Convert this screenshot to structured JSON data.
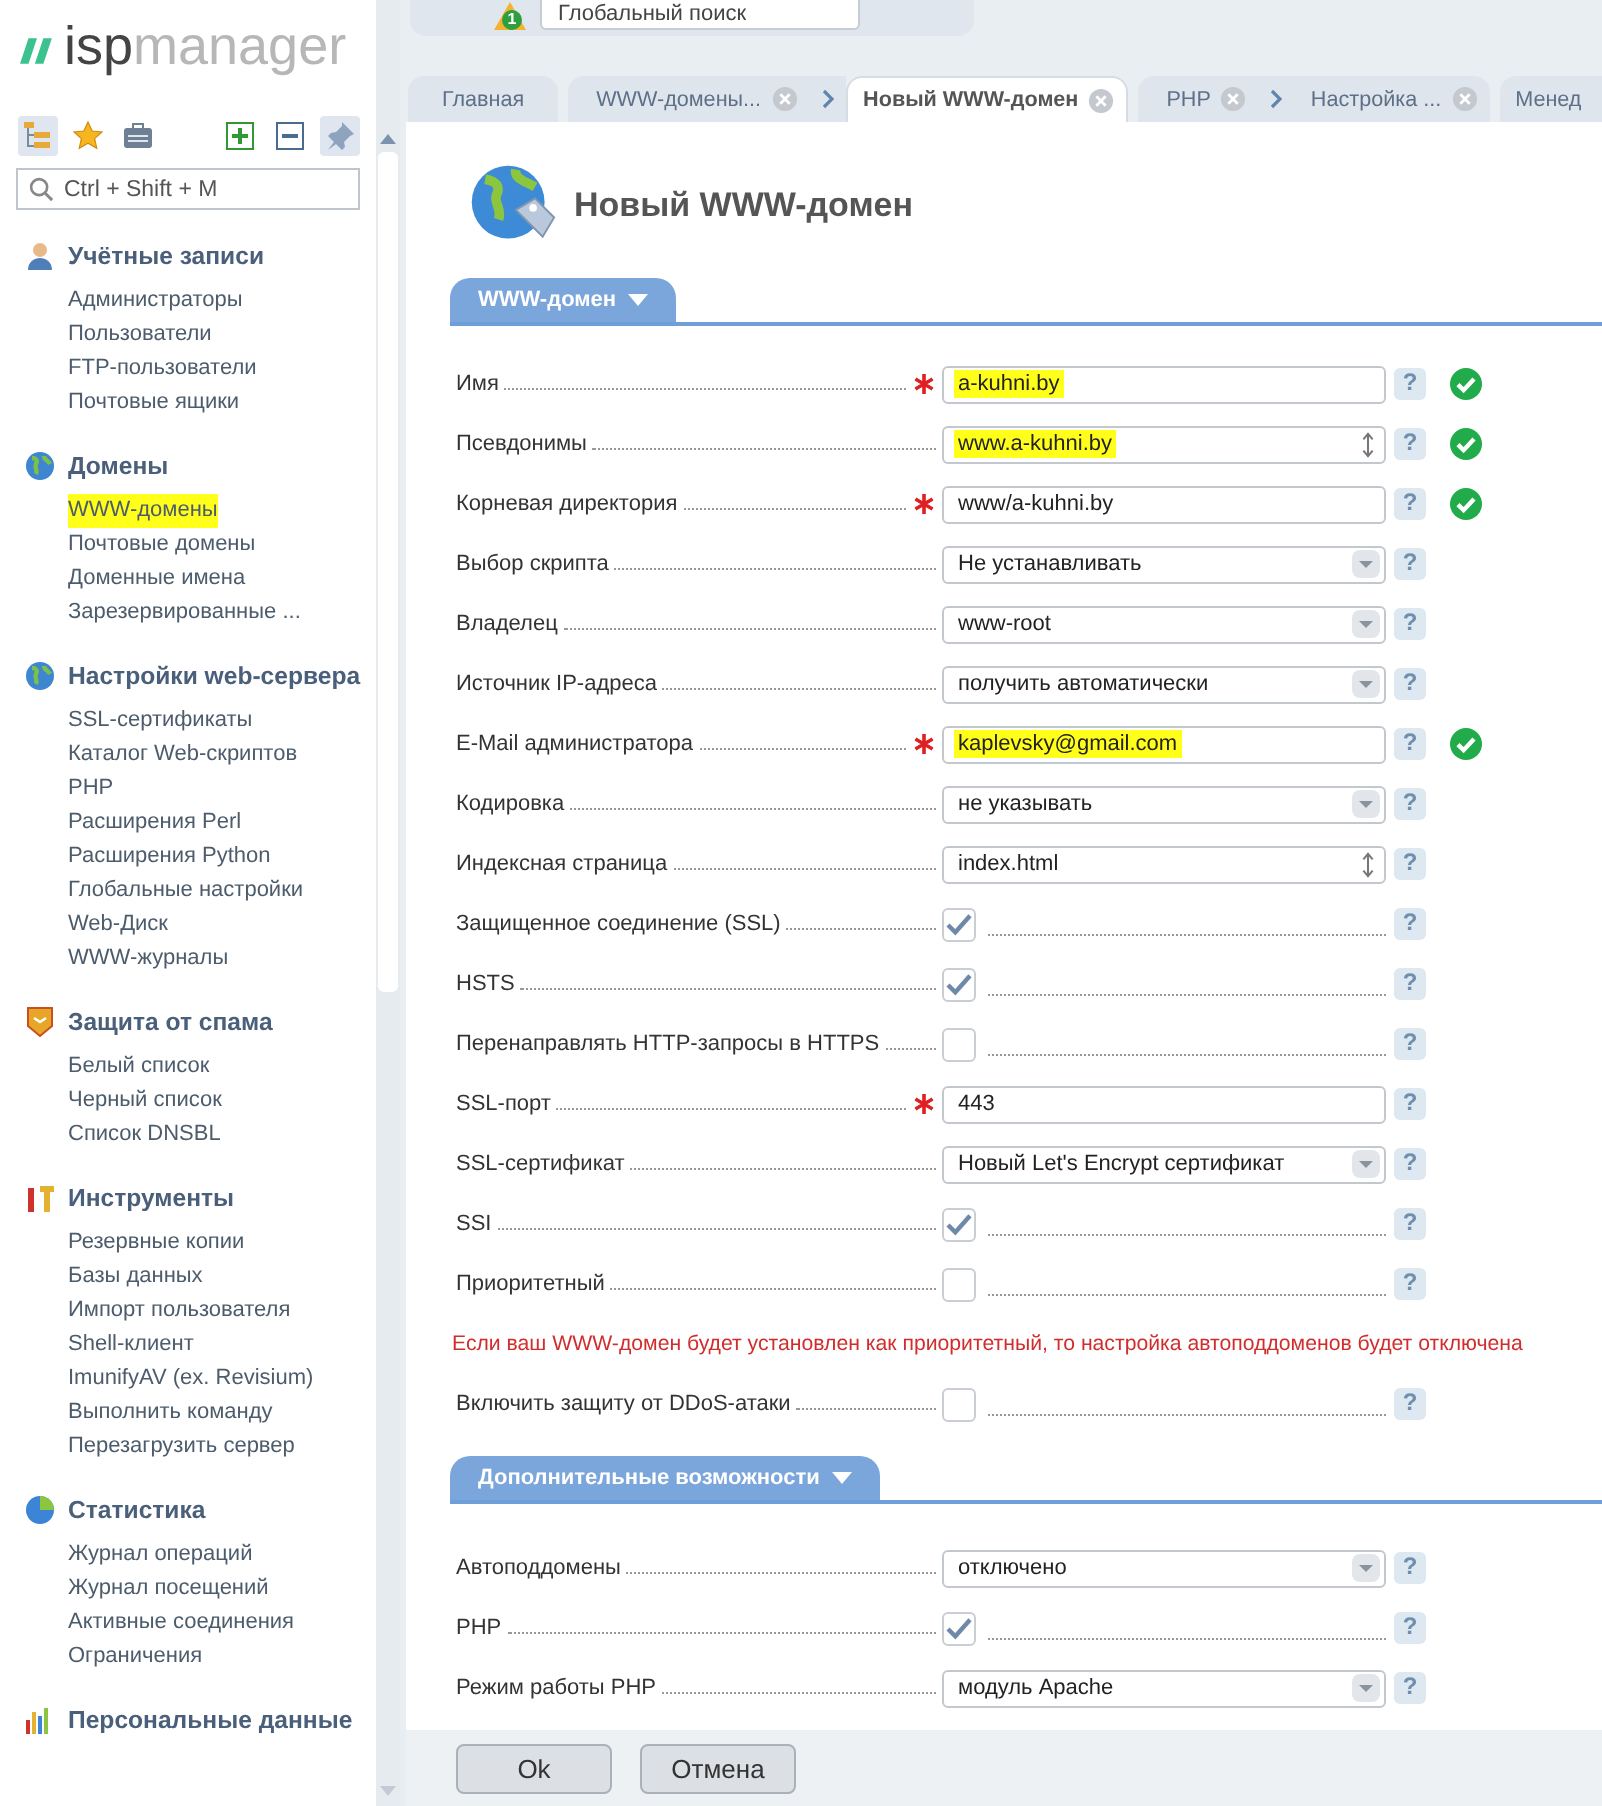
{
  "logo": {
    "prefix": "isp",
    "suffix": "manager"
  },
  "sidebar_toolbar": [
    {
      "selected": true
    },
    {
      "selected": false
    },
    {
      "selected": false
    },
    {
      "selected": false
    },
    {
      "selected": false
    },
    {
      "selected": true
    }
  ],
  "sidebar_search": {
    "placeholder": "Ctrl + Shift + M"
  },
  "sidebar": {
    "groups": [
      {
        "title": "Учётные записи",
        "items": [
          {
            "label": "Администраторы",
            "highlighted": false
          },
          {
            "label": "Пользователи",
            "highlighted": false
          },
          {
            "label": "FTP-пользователи",
            "highlighted": false
          },
          {
            "label": "Почтовые ящики",
            "highlighted": false
          }
        ]
      },
      {
        "title": "Домены",
        "items": [
          {
            "label": "WWW-домены",
            "highlighted": true
          },
          {
            "label": "Почтовые домены",
            "highlighted": false
          },
          {
            "label": "Доменные имена",
            "highlighted": false
          },
          {
            "label": "Зарезервированные ...",
            "highlighted": false
          }
        ]
      },
      {
        "title": "Настройки web-сервера",
        "items": [
          {
            "label": "SSL-сертификаты",
            "highlighted": false
          },
          {
            "label": "Каталог Web-скриптов",
            "highlighted": false
          },
          {
            "label": "PHP",
            "highlighted": false
          },
          {
            "label": "Расширения Perl",
            "highlighted": false
          },
          {
            "label": "Расширения Python",
            "highlighted": false
          },
          {
            "label": "Глобальные настройки",
            "highlighted": false
          },
          {
            "label": "Web-Диск",
            "highlighted": false
          },
          {
            "label": "WWW-журналы",
            "highlighted": false
          }
        ]
      },
      {
        "title": "Защита от спама",
        "items": [
          {
            "label": "Белый список",
            "highlighted": false
          },
          {
            "label": "Черный список",
            "highlighted": false
          },
          {
            "label": "Список DNSBL",
            "highlighted": false
          }
        ]
      },
      {
        "title": "Инструменты",
        "items": [
          {
            "label": "Резервные копии",
            "highlighted": false
          },
          {
            "label": "Базы данных",
            "highlighted": false
          },
          {
            "label": "Импорт пользователя",
            "highlighted": false
          },
          {
            "label": "Shell-клиент",
            "highlighted": false
          },
          {
            "label": "ImunifyAV (ex. Revisium)",
            "highlighted": false
          },
          {
            "label": "Выполнить команду",
            "highlighted": false
          },
          {
            "label": "Перезагрузить сервер",
            "highlighted": false
          }
        ]
      },
      {
        "title": "Статистика",
        "items": [
          {
            "label": "Журнал операций",
            "highlighted": false
          },
          {
            "label": "Журнал посещений",
            "highlighted": false
          },
          {
            "label": "Активные соединения",
            "highlighted": false
          },
          {
            "label": "Ограничения",
            "highlighted": false
          }
        ]
      },
      {
        "title": "Персональные данные"
      }
    ]
  },
  "header": {
    "alert_count": "1",
    "search": {
      "placeholder": "Глобальный поиск"
    }
  },
  "tabs": [
    {
      "label": "Главная",
      "selected": false,
      "closable": false,
      "linked": false
    },
    {
      "label": "WWW-домены...",
      "selected": false,
      "closable": true,
      "linked": false
    },
    {
      "label": "Новый WWW-домен",
      "selected": true,
      "closable": true,
      "linked": true
    },
    {
      "label": "PHP",
      "selected": false,
      "closable": true,
      "linked": false
    },
    {
      "label": "Настройка ...",
      "selected": false,
      "closable": true,
      "linked": true
    },
    {
      "label": "Менед",
      "selected": false,
      "closable": false,
      "linked": false
    }
  ],
  "page_title": "Новый WWW-домен",
  "sections": [
    {
      "title": "WWW-домен",
      "rows": [
        {
          "kind": "text",
          "label": "Имя",
          "required": true,
          "value": "a-kuhni.by",
          "highlighted": true,
          "valid": true,
          "help": "?"
        },
        {
          "kind": "spin",
          "label": "Псевдонимы",
          "required": false,
          "value": "www.a-kuhni.by",
          "highlighted": true,
          "valid": true,
          "help": "?"
        },
        {
          "kind": "text",
          "label": "Корневая директория",
          "required": true,
          "value": "www/a-kuhni.by",
          "highlighted": false,
          "valid": true,
          "help": "?"
        },
        {
          "kind": "select",
          "label": "Выбор скрипта",
          "required": false,
          "value": "Не устанавливать",
          "highlighted": false,
          "valid": false,
          "help": "?"
        },
        {
          "kind": "select",
          "label": "Владелец",
          "required": false,
          "value": "www-root",
          "highlighted": false,
          "valid": false,
          "help": "?"
        },
        {
          "kind": "select",
          "label": "Источник IP-адреса",
          "required": false,
          "value": "получить автоматически",
          "highlighted": false,
          "valid": false,
          "help": "?"
        },
        {
          "kind": "text",
          "label": "E-Mail администратора",
          "required": true,
          "value": "kaplevsky@gmail.com",
          "highlighted": true,
          "valid": true,
          "help": "?"
        },
        {
          "kind": "select",
          "label": "Кодировка",
          "required": false,
          "value": "не указывать",
          "highlighted": false,
          "valid": false,
          "help": "?"
        },
        {
          "kind": "spin",
          "label": "Индексная страница",
          "required": false,
          "value": "index.html",
          "highlighted": false,
          "valid": false,
          "help": "?"
        },
        {
          "kind": "checkbox",
          "label": "Защищенное соединение (SSL)",
          "checked": true,
          "help": "?"
        },
        {
          "kind": "checkbox",
          "label": "HSTS",
          "checked": true,
          "help": "?"
        },
        {
          "kind": "checkbox",
          "label": "Перенаправлять HTTP-запросы в HTTPS",
          "checked": false,
          "help": "?"
        },
        {
          "kind": "text",
          "label": "SSL-порт",
          "required": true,
          "value": "443",
          "highlighted": false,
          "valid": false,
          "help": "?"
        },
        {
          "kind": "select",
          "label": "SSL-сертификат",
          "required": false,
          "value": "Новый Let's Encrypt сертификат",
          "highlighted": false,
          "valid": false,
          "help": "?"
        },
        {
          "kind": "checkbox",
          "label": "SSI",
          "checked": true,
          "help": "?"
        },
        {
          "kind": "checkbox",
          "label": "Приоритетный",
          "checked": false,
          "help": "?"
        },
        {
          "kind": "note",
          "text": "Если ваш WWW-домен будет установлен как приоритетный, то настройка автоподдоменов будет отключена"
        },
        {
          "kind": "checkbox",
          "label": "Включить защиту от DDoS-атаки",
          "checked": false,
          "help": "?"
        }
      ]
    },
    {
      "title": "Дополнительные возможности",
      "rows": [
        {
          "kind": "select",
          "label": "Автоподдомены",
          "required": false,
          "value": "отключено",
          "highlighted": false,
          "valid": false,
          "help": "?"
        },
        {
          "kind": "checkbox",
          "label": "PHP",
          "checked": true,
          "help": "?"
        },
        {
          "kind": "select",
          "label": "Режим работы PHP",
          "required": false,
          "value": "модуль Apache",
          "highlighted": false,
          "valid": false,
          "help": "?"
        }
      ]
    }
  ],
  "buttons": [
    {
      "label": "Ok"
    },
    {
      "label": "Отмена"
    }
  ]
}
